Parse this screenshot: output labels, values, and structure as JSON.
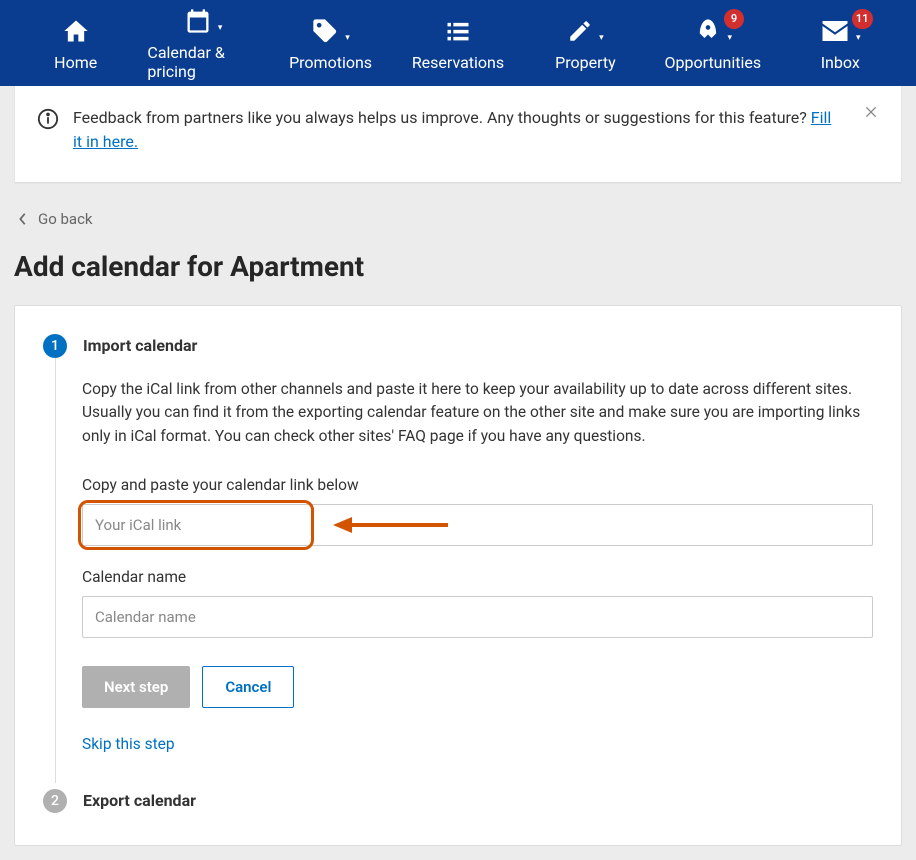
{
  "nav": {
    "items": [
      {
        "label": "Home"
      },
      {
        "label": "Calendar & pricing"
      },
      {
        "label": "Promotions"
      },
      {
        "label": "Reservations"
      },
      {
        "label": "Property"
      },
      {
        "label": "Opportunities",
        "badge": "9"
      },
      {
        "label": "Inbox",
        "badge": "11"
      }
    ]
  },
  "feedback": {
    "text_before": "Feedback from partners like you always helps us improve. Any thoughts or suggestions for this feature? ",
    "link_text": "Fill it in here."
  },
  "goback": "Go back",
  "page_title": "Add calendar for Apartment",
  "step1": {
    "number": "1",
    "title": "Import calendar",
    "desc": "Copy the iCal link from other channels and paste it here to keep your availability up to date across different sites. Usually you can find it from the exporting calendar feature on the other site and make sure you are importing links only in iCal format. You can check other sites' FAQ page if you have any questions.",
    "ical_label": "Copy and paste your calendar link below",
    "ical_placeholder": "Your iCal link",
    "name_label": "Calendar name",
    "name_placeholder": "Calendar name",
    "next": "Next step",
    "cancel": "Cancel",
    "skip": "Skip this step"
  },
  "step2": {
    "number": "2",
    "title": "Export calendar"
  }
}
